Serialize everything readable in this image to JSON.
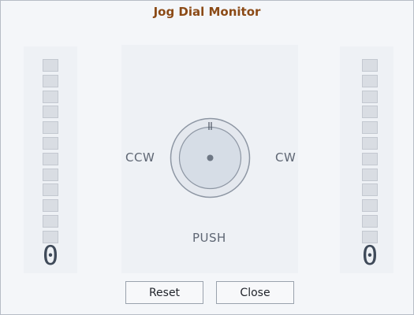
{
  "window": {
    "title": "Jog Dial Monitor"
  },
  "left_meter": {
    "count": "0",
    "segments_total": 12,
    "segments_lit": 0
  },
  "right_meter": {
    "count": "0",
    "segments_total": 12,
    "segments_lit": 0
  },
  "dial": {
    "ccw_label": "CCW",
    "cw_label": "CW",
    "push_label": "PUSH"
  },
  "buttons": {
    "reset_label": "Reset",
    "close_label": "Close"
  },
  "colors": {
    "title": "#8b4a16",
    "segment_off": "#d9dde3",
    "segment_on": "#3f7fd6",
    "digit": "#3f4a59"
  }
}
